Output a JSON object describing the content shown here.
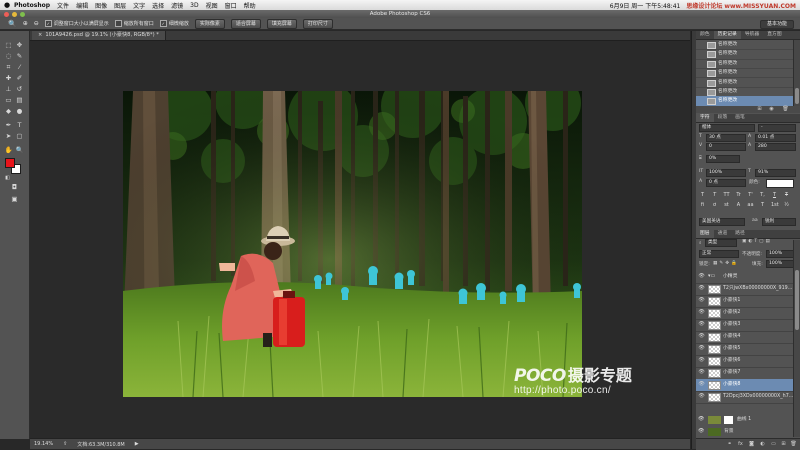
{
  "menubar": {
    "apple": "",
    "app_name": "Photoshop",
    "items": [
      "文件",
      "编辑",
      "图像",
      "图层",
      "文字",
      "选择",
      "滤镜",
      "3D",
      "视图",
      "窗口",
      "帮助"
    ],
    "clock": "6月9日 周一 下午5:48:41",
    "site_watermark": "思缘设计论坛 www.MISSYUAN.COM"
  },
  "window": {
    "title": "Adobe Photoshop CS6"
  },
  "options": {
    "checkbox_resize": "调整窗口大小以满屏显示",
    "checkbox_zoom_all": "缩放所有窗口",
    "checkbox_scrubby": "细微缩放",
    "btn_actual": "实际像素",
    "btn_fit": "适合屏幕",
    "btn_fill": "填充屏幕",
    "btn_print": "打印尺寸",
    "workspace": "基本功能"
  },
  "document": {
    "tab_label": "101A9426.psd @ 19.1% (小豪快8, RGB/8*) *",
    "close_glyph": "×"
  },
  "status": {
    "zoom": "19.14%",
    "doc_size": "文档:63.3M/310.8M"
  },
  "photo_watermark": {
    "brand": "POCO",
    "channel": "摄影专题",
    "url": "http://photo.poco.cn/"
  },
  "history_panel": {
    "tabs": [
      "颜色",
      "历史记录",
      "导航器",
      "直方图"
    ],
    "active_tab": "历史记录",
    "items": [
      {
        "label": "名称更改",
        "selected": false
      },
      {
        "label": "名称更改",
        "selected": false
      },
      {
        "label": "名称更改",
        "selected": false
      },
      {
        "label": "名称更改",
        "selected": false
      },
      {
        "label": "名称更改",
        "selected": false
      },
      {
        "label": "名称更改",
        "selected": false
      },
      {
        "label": "名称更改",
        "selected": true
      }
    ]
  },
  "character_panel": {
    "tabs": [
      "字符",
      "段落",
      "画笔"
    ],
    "font_family": "楷体",
    "font_style": "-",
    "font_size": "30 点",
    "leading": "0.01 点",
    "kerning": "0",
    "tracking": "280",
    "scale_percent": "0%",
    "vertical_scale": "100%",
    "horizontal_scale": "91%",
    "baseline": "0 点",
    "color_label": "颜色:",
    "style_buttons": [
      "T",
      "T",
      "TT",
      "Tr",
      "T'",
      "T,",
      "T",
      "T"
    ],
    "opentype_buttons": [
      "fi",
      "ơ",
      "st",
      "A",
      "aa",
      "T",
      "1st",
      "½"
    ],
    "language": "美国英语",
    "antialias": "锐利",
    "aa_label": "aa"
  },
  "layers_panel": {
    "tabs": [
      "图层",
      "通道",
      "路径"
    ],
    "filter_kind": "类型",
    "blend_mode": "正常",
    "opacity_label": "不透明度:",
    "opacity": "100%",
    "lock_label": "锁定:",
    "fill_label": "填充:",
    "fill": "100%",
    "group_name": "小精灵",
    "layers": [
      {
        "name": "T2只jwXBx00000000X_919...",
        "selected": false
      },
      {
        "name": "小豪快1",
        "selected": false
      },
      {
        "name": "小豪快2",
        "selected": false
      },
      {
        "name": "小豪快3",
        "selected": false
      },
      {
        "name": "小豪快4",
        "selected": false
      },
      {
        "name": "小豪快5",
        "selected": false
      },
      {
        "name": "小豪快6",
        "selected": false
      },
      {
        "name": "小豪快7",
        "selected": false
      },
      {
        "name": "小豪快8",
        "selected": true
      },
      {
        "name": "T2Dpcj3XDx00000000X_h7...",
        "selected": false
      }
    ],
    "adjustment_layer": "选取颜色 1",
    "curves_layer": "曲线 1",
    "background_layer": "背景"
  },
  "icons": [
    "marquee-icon",
    "move-icon",
    "lasso-icon",
    "quick-select-icon",
    "crop-icon",
    "eyedropper-icon",
    "healing-icon",
    "brush-icon",
    "stamp-icon",
    "history-brush-icon",
    "eraser-icon",
    "gradient-icon",
    "blur-icon",
    "dodge-icon",
    "pen-icon",
    "type-icon",
    "path-select-icon",
    "shape-icon",
    "hand-icon",
    "zoom-icon",
    "eye-icon",
    "folder-icon",
    "link-icon",
    "trash-icon"
  ],
  "colors": {
    "foreground": "#e8141b",
    "background": "#ffffff",
    "selection": "#6c8bb2"
  }
}
